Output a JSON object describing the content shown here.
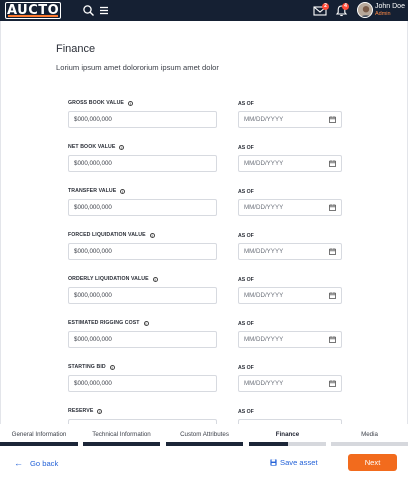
{
  "topbar": {
    "logo_text": "AUCTO",
    "mail_badge": "2",
    "bell_badge": "4",
    "user_name": "John Doe",
    "user_role": "Admin",
    "icons": [
      "search-icon",
      "menu-icon",
      "mail-icon",
      "bell-icon",
      "avatar"
    ]
  },
  "page": {
    "title": "Finance",
    "subtitle": "Lorium ipsum amet dolororium ipsum amet dolor"
  },
  "fields": [
    {
      "label": "GROSS BOOK VALUE",
      "value": "$000,000,000",
      "asof_label": "AS OF",
      "date_placeholder": "MM/DD/YYYY"
    },
    {
      "label": "NET BOOK VALUE",
      "value": "$000,000,000",
      "asof_label": "AS OF",
      "date_placeholder": "MM/DD/YYYY"
    },
    {
      "label": "TRANSFER VALUE",
      "value": "$000,000,000",
      "asof_label": "AS OF",
      "date_placeholder": "MM/DD/YYYY"
    },
    {
      "label": "FORCED LIQUIDATION VALUE",
      "value": "$000,000,000",
      "asof_label": "AS OF",
      "date_placeholder": "MM/DD/YYYY"
    },
    {
      "label": "ORDERLY LIQUIDATION VALUE",
      "value": "$000,000,000",
      "asof_label": "AS OF",
      "date_placeholder": "MM/DD/YYYY"
    },
    {
      "label": "ESTIMATED RIGGING COST",
      "value": "$000,000,000",
      "asof_label": "AS OF",
      "date_placeholder": "MM/DD/YYYY"
    },
    {
      "label": "STARTING BID",
      "value": "$000,000,000",
      "asof_label": "AS OF",
      "date_placeholder": "MM/DD/YYYY"
    },
    {
      "label": "RESERVE",
      "value": "",
      "asof_label": "AS OF",
      "date_placeholder": ""
    }
  ],
  "steps": [
    {
      "label": "General Information",
      "state": "complete"
    },
    {
      "label": "Technical Information",
      "state": "complete"
    },
    {
      "label": "Custom Attributes",
      "state": "complete"
    },
    {
      "label": "Finance",
      "state": "active"
    },
    {
      "label": "Media",
      "state": "pending"
    }
  ],
  "footer": {
    "back_label": "Go back",
    "save_label": "Save asset",
    "next_label": "Next"
  },
  "colors": {
    "topbar": "#152033",
    "accent": "#f26b1d",
    "link": "#2563d8",
    "step_complete": "#1c2638",
    "step_pending": "#d6d8dd"
  }
}
